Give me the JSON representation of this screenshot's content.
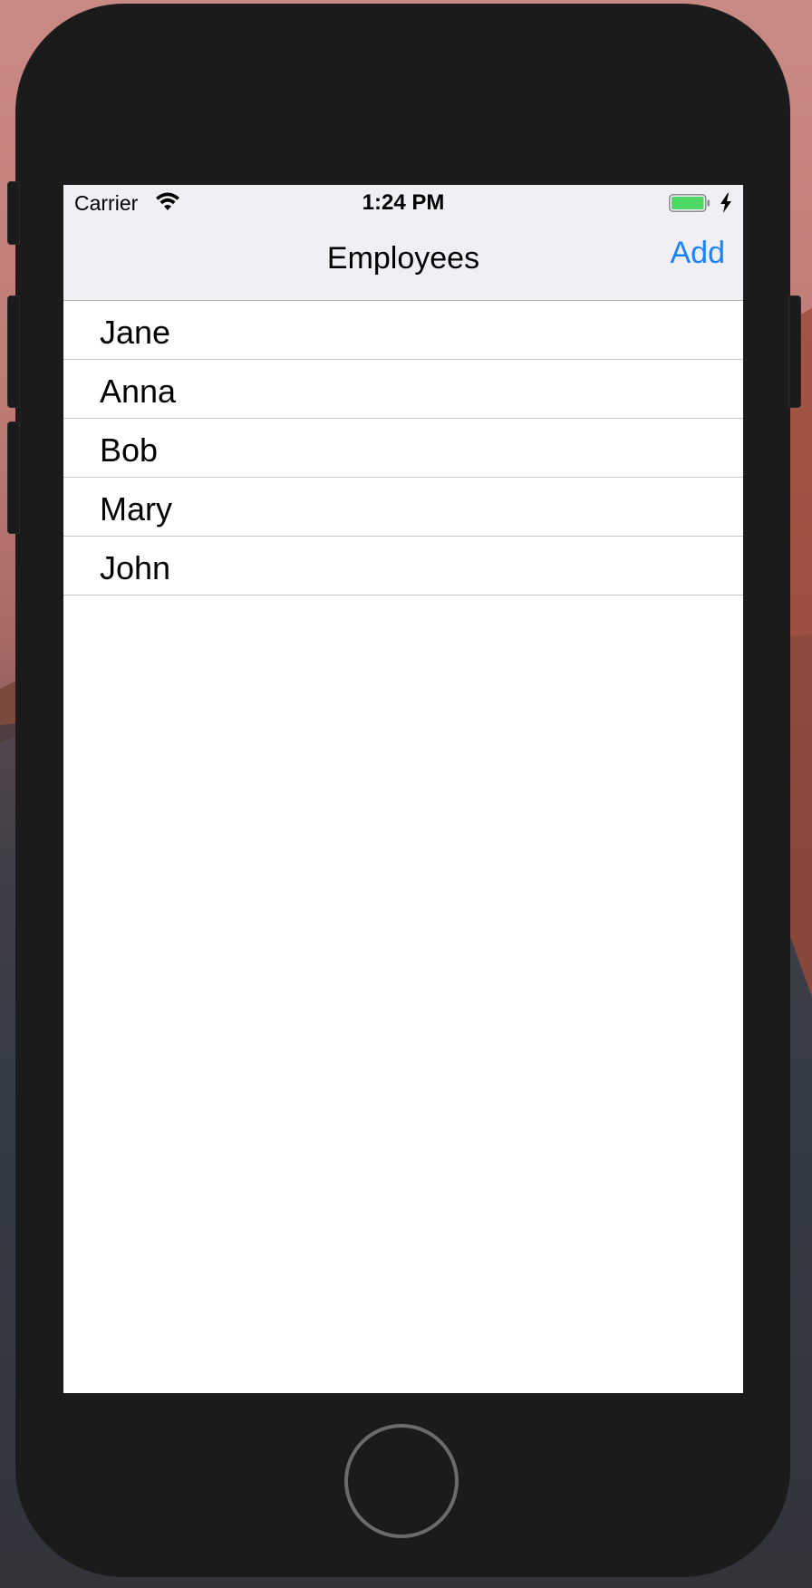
{
  "status_bar": {
    "carrier": "Carrier",
    "time": "1:24 PM",
    "wifi_icon": "wifi-icon",
    "battery_icon": "battery-icon",
    "charging_icon": "bolt-icon",
    "battery_color": "#4cd964"
  },
  "nav_bar": {
    "title": "Employees",
    "add_label": "Add",
    "accent_color": "#1a82fb"
  },
  "employees": [
    {
      "name": "Jane"
    },
    {
      "name": "Anna"
    },
    {
      "name": "Bob"
    },
    {
      "name": "Mary"
    },
    {
      "name": "John"
    }
  ],
  "device": {
    "home_button_icon": "home-button-icon"
  }
}
